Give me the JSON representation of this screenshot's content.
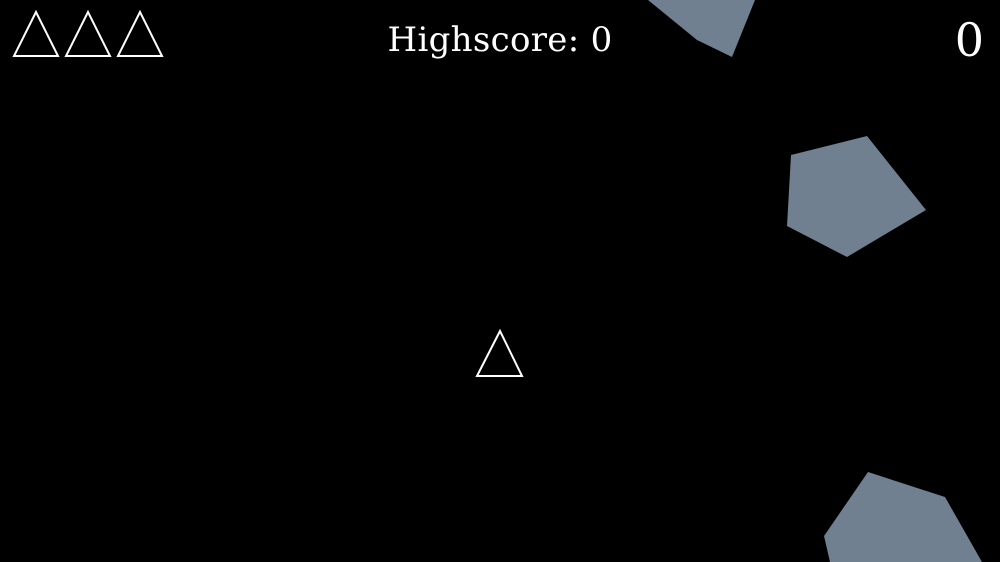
{
  "hud": {
    "highscore_label": "Highscore: 0",
    "score": "0",
    "lives": 3
  },
  "colors": {
    "background": "#000000",
    "ship_stroke": "#ffffff",
    "asteroid_fill": "#708090"
  },
  "icons": {
    "life": "ship-outline-icon",
    "player": "player-ship-icon",
    "asteroid": "asteroid-shape"
  },
  "asteroids_visible": 3
}
